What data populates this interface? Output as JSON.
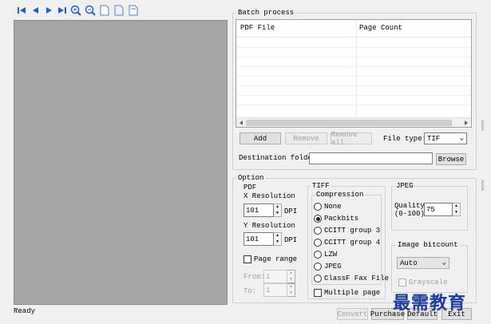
{
  "toolbar": {
    "icons": [
      "first-page-icon",
      "prev-page-icon",
      "next-page-icon",
      "last-page-icon",
      "zoom-in-icon",
      "zoom-out-icon",
      "page-icon",
      "page-icon",
      "page-icon"
    ]
  },
  "status": {
    "text": "Ready"
  },
  "batch": {
    "title": "Batch process",
    "columns": [
      "PDF File",
      "Page Count"
    ],
    "buttons": {
      "add": "Add",
      "remove": "Remove",
      "remove_all": "Remove all"
    },
    "file_type_label": "File type:",
    "file_type_value": "TIF",
    "destination_label": "Destination folder",
    "destination_value": "",
    "browse": "Browse"
  },
  "option": {
    "title": "Option",
    "pdf": {
      "title": "PDF",
      "x_res_label": "X Resolution",
      "x_res_value": "101",
      "y_res_label": "Y Resolution",
      "y_res_value": "101",
      "dpi": "DPI",
      "page_range_label": "Page range",
      "from_label": "From:",
      "from_value": "1",
      "to_label": "To:",
      "to_value": "1"
    },
    "tiff": {
      "title": "TIFF",
      "compression_title": "Compression",
      "options": [
        "None",
        "Packbits",
        "CCITT group 3",
        "CCITT group 4",
        "LZW",
        "JPEG",
        "ClassF Fax File"
      ],
      "selected": "Packbits",
      "multiple_page": "Multiple page"
    },
    "jpeg": {
      "title": "JPEG",
      "quality_label": "Quality",
      "quality_range": "(0-100)",
      "quality_value": "75"
    },
    "bitcount": {
      "title": "Image bitcount",
      "value": "Auto",
      "grayscale": "Grayscale"
    }
  },
  "footer": {
    "convert": "Convert",
    "purchase": "Purchase",
    "default": "Default",
    "exit": "Exit"
  },
  "watermark": "最需教育"
}
